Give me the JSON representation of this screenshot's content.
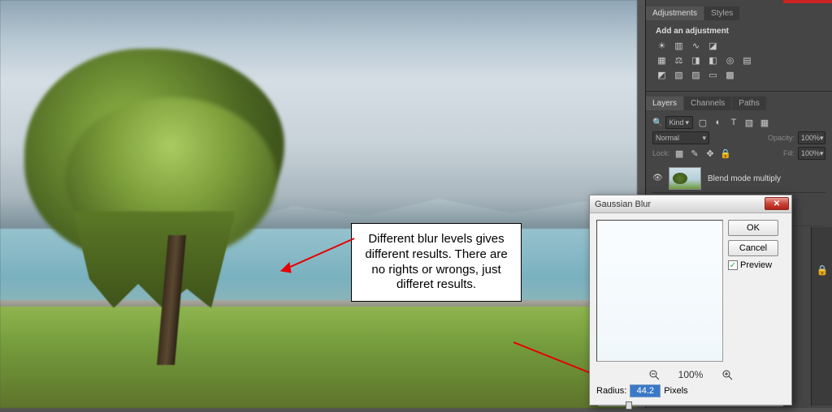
{
  "panels": {
    "adjustments": {
      "tabs": [
        "Adjustments",
        "Styles"
      ],
      "title": "Add an adjustment"
    },
    "layers": {
      "tabs": [
        "Layers",
        "Channels",
        "Paths"
      ],
      "kind_filter": "Kind",
      "blend_mode": "Normal",
      "opacity_label": "Opacity:",
      "opacity_value": "100%",
      "lock_label": "Lock:",
      "fill_label": "Fill:",
      "fill_value": "100%",
      "layer1_name": "Blend mode multiply"
    }
  },
  "annotation": {
    "text": "Different blur levels gives different results. There are no rights or wrongs, just differet results."
  },
  "dialog": {
    "title": "Gaussian Blur",
    "ok": "OK",
    "cancel": "Cancel",
    "preview_label": "Preview",
    "preview_checked": true,
    "zoom_pct": "100%",
    "radius_label": "Radius:",
    "radius_value": "44.2",
    "radius_unit": "Pixels"
  }
}
